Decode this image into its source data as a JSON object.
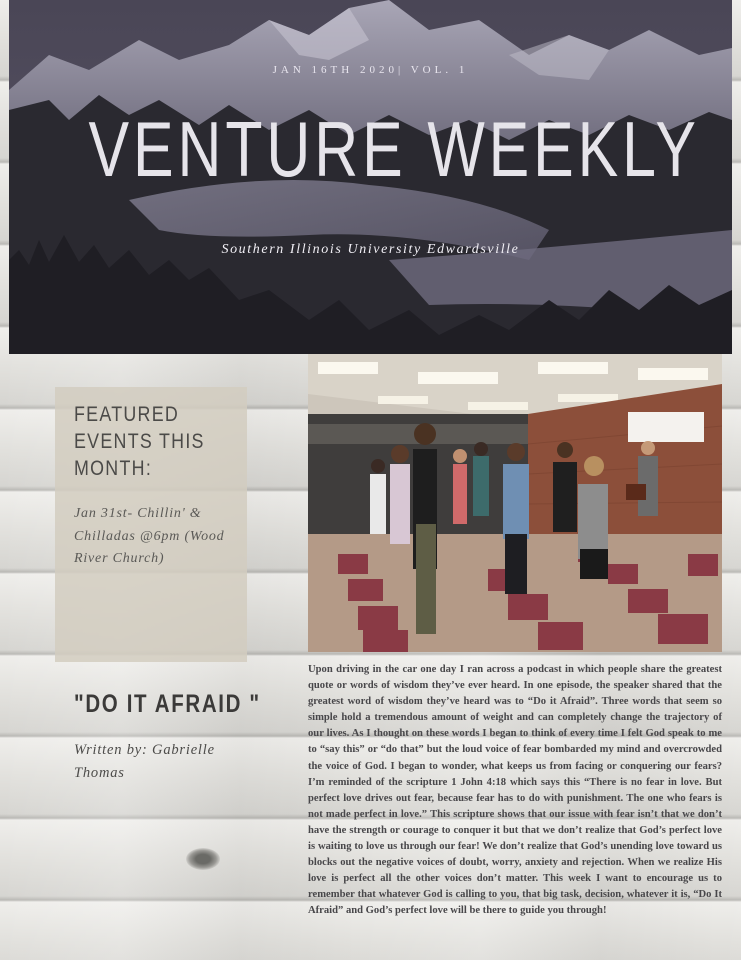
{
  "header": {
    "dateline": "JAN 16TH 2020| VOL. 1",
    "title": "VENTURE WEEKLY",
    "subtitle": "Southern Illinois University Edwardsville"
  },
  "featured": {
    "heading": "FEATURED EVENTS THIS MONTH:",
    "event": "Jan 31st- Chillin' & Chilladas @6pm (Wood River Church)"
  },
  "article": {
    "title": "\"DO IT AFRAID \"",
    "byline": "Written by: Gabrielle Thomas",
    "body": "Upon driving in the car one day I ran across a podcast in which people share the greatest quote or words of wisdom they’ve ever heard. In one episode, the speaker shared that the greatest word of wisdom they’ve heard was to “Do it Afraid”. Three words that seem so simple hold a tremendous amount of weight and can completely change the trajectory of our lives. As I thought on these words I began to think of every time I felt God speak to me to “say this” or “do that” but the loud voice of fear bombarded my mind and overcrowded the voice of God. I began to wonder, what keeps us from facing or conquering our fears? I’m reminded of the scripture 1 John 4:18 which says this “There is no fear in love. But perfect love drives out fear, because fear has to do with punishment. The one who fears is not made perfect in love.” This scripture shows that our issue with fear isn’t that we don’t have the strength or courage to conquer it but that we don’t realize that God’s perfect love is waiting to love us through our fear! We don’t realize that God’s unending love toward us blocks out the negative voices of doubt, worry, anxiety and rejection. When we realize His love is perfect all the other voices don’t matter. This week I want to encourage us to remember that whatever God is calling to you, that big task, decision, whatever it is, “Do It Afraid” and God’s perfect love will be there to guide you through!"
  }
}
